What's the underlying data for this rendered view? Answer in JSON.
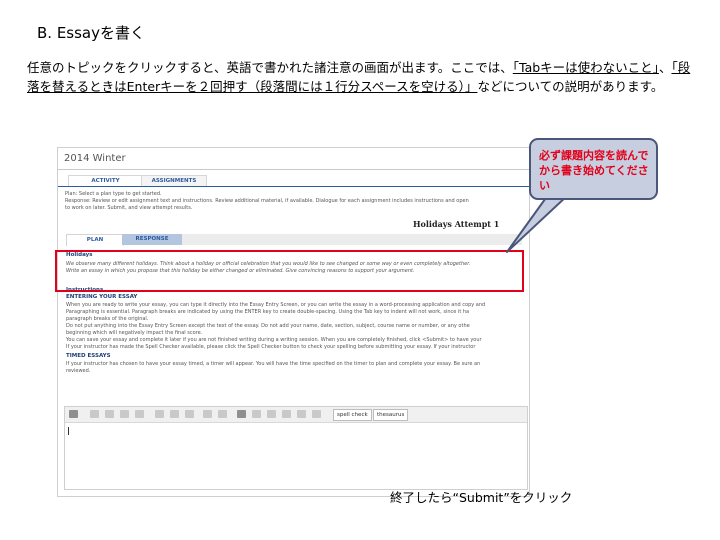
{
  "heading": "B. Essayを書く",
  "intro": {
    "part1": "任意のトピックをクリックすると、英語で書かれた諸注意の画面が出ます。ここでは、",
    "underline1": "「Tabキーは使わないこと」",
    "part2": "、",
    "underline2": "「段落を替えるときはEnterキーを２回押す（段落間には１行分スペースを空ける）」",
    "part3": "などについての説明があります。"
  },
  "screenshot": {
    "title": "2014 Winter",
    "tabs": [
      "ACTIVITY",
      "ASSIGNMENTS"
    ],
    "plan_lines": [
      "Plan: Select a plan type to get started.",
      "Response: Review or edit assignment text and instructions. Review additional material, if available. Dialogue for each assignment includes instructions and open",
      "to work on later. Submit, and view attempt results."
    ],
    "holidays_header": "Holidays   Attempt 1",
    "sub_tabs": [
      "PLAN",
      "RESPONSE"
    ],
    "holidays_title": "Holidays",
    "holidays_lines": [
      "We observe many different holidays. Think about a holiday or official celebration that you would like to see changed or some way or even completely altogether.",
      "Write an essay in which you propose that this holiday be either changed or eliminated. Give convincing reasons to support your argument."
    ],
    "instructions_title": "Instructions",
    "entering_title": "ENTERING YOUR ESSAY",
    "entering_lines": [
      "When you are ready to write your essay, you can type it directly into the Essay Entry Screen, or you can write the essay in a word-processing application and copy and",
      "Paragraphing is essential. Paragraph breaks are indicated by using the ENTER key to create double-spacing. Using the Tab key to indent will not work, since it ha",
      "paragraph breaks of the original.",
      "Do not put anything into the Essay Entry Screen except the text of the essay. Do not add your name, date, section, subject, course name or number, or any othe",
      "beginning which will negatively impact the final score.",
      "You can save your essay and complete it later if you are not finished writing during a writing session. When you are completely finished, click <Submit> to have your",
      "If your instructor has made the Spell Checker available, please click the Spell Checker button to check your spelling before submitting your essay. If your instructor"
    ],
    "timed_title": "TIMED ESSAYS",
    "timed_lines": [
      "If your instructor has chosen to have your essay timed, a timer will appear. You will have the time specified on the timer to plan and complete your essay. Be sure an",
      "reviewed."
    ],
    "toolbar": {
      "spell_check": "spell check",
      "thesaurus": "thesaurus"
    }
  },
  "callout": "必ず課題内容を読んでから書き始めてください",
  "footer": "終了したら“Submit”をクリック",
  "colors": {
    "red": "#e2001a",
    "callout_bg": "#c7cedf",
    "callout_border": "#4a567a",
    "link_blue": "#2b5c9e"
  }
}
